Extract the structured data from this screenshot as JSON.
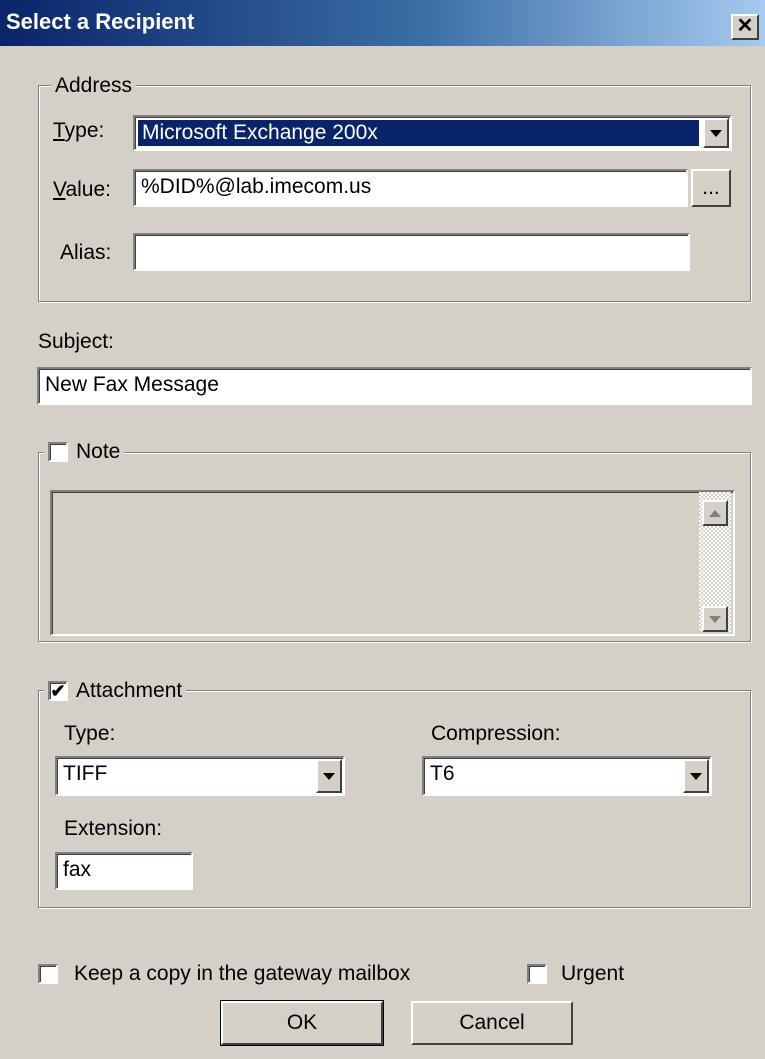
{
  "window": {
    "title": "Select a Recipient",
    "close_glyph": "✕"
  },
  "address": {
    "legend": "Address",
    "type_label_first": "T",
    "type_label_rest": "ype:",
    "type_value": "Microsoft Exchange 200x",
    "value_label_first": "V",
    "value_label_rest": "alue:",
    "value_value": "%DID%@lab.imecom.us",
    "browse_label": "...",
    "alias_label": "Alias:",
    "alias_value": ""
  },
  "subject": {
    "label": "Subject:",
    "value": "New Fax Message"
  },
  "note": {
    "label": "Note",
    "checked": false,
    "value": ""
  },
  "attachment": {
    "label": "Attachment",
    "checked": true,
    "check_glyph": "✔",
    "type_label": "Type:",
    "type_value": "TIFF",
    "compression_label": "Compression:",
    "compression_value": "T6",
    "extension_label": "Extension:",
    "extension_value": "fax"
  },
  "options": {
    "keep_copy_label": "Keep a copy in the gateway mailbox",
    "keep_copy_checked": false,
    "urgent_label": "Urgent",
    "urgent_checked": false
  },
  "buttons": {
    "ok": "OK",
    "cancel": "Cancel"
  },
  "icons": {
    "close": "close-icon",
    "dropdown": "chevron-down-icon",
    "scroll_up": "scroll-up-icon",
    "scroll_down": "scroll-down-icon",
    "checkmark": "checkmark-icon"
  }
}
